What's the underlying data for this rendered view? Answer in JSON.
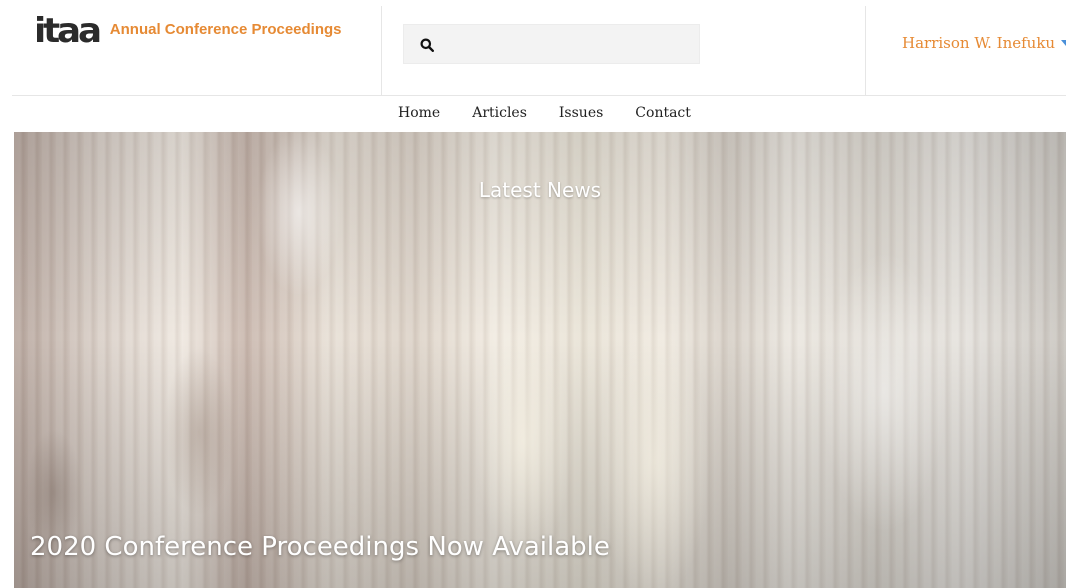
{
  "header": {
    "logo_mark": "itaa",
    "site_title": "Annual Conference Proceedings",
    "search": {
      "value": "",
      "placeholder": ""
    },
    "user_name": "Harrison W. Inefuku"
  },
  "nav": {
    "items": [
      {
        "label": "Home"
      },
      {
        "label": "Articles"
      },
      {
        "label": "Issues"
      },
      {
        "label": "Contact"
      }
    ]
  },
  "hero": {
    "heading": "Latest News",
    "caption": "2020 Conference Proceedings Now Available"
  },
  "colors": {
    "accent": "#e68a34",
    "caret": "#4a90d9",
    "nav_text": "#222222"
  },
  "icons": {
    "search": "search-icon",
    "dropdown": "caret-down-icon"
  }
}
